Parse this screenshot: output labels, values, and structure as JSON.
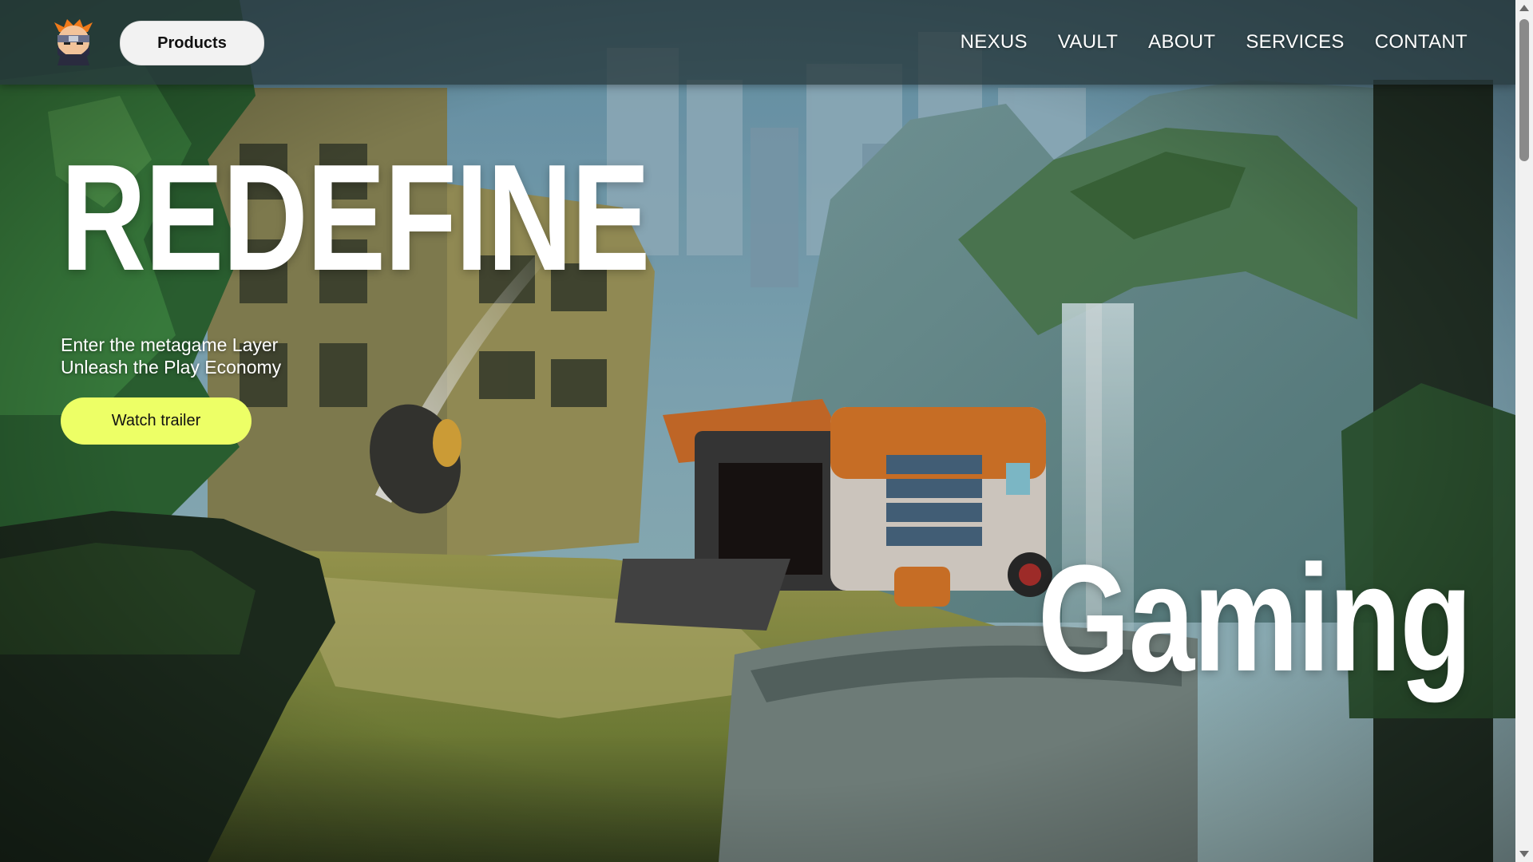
{
  "navbar": {
    "logo_icon": "ninja-avatar-icon",
    "products_label": "Products",
    "links": [
      "NEXUS",
      "VAULT",
      "ABOUT",
      "SERVICES",
      "CONTANT"
    ]
  },
  "hero": {
    "title": "REDEFINE",
    "tagline_line1": "Enter the metagame Layer",
    "tagline_line2": "Unleash the Play Economy",
    "cta_label": "Watch trailer",
    "subtitle": "Gaming"
  },
  "colors": {
    "cta_background": "#edff66",
    "products_background": "#f2f2f2",
    "text": "#ffffff"
  }
}
